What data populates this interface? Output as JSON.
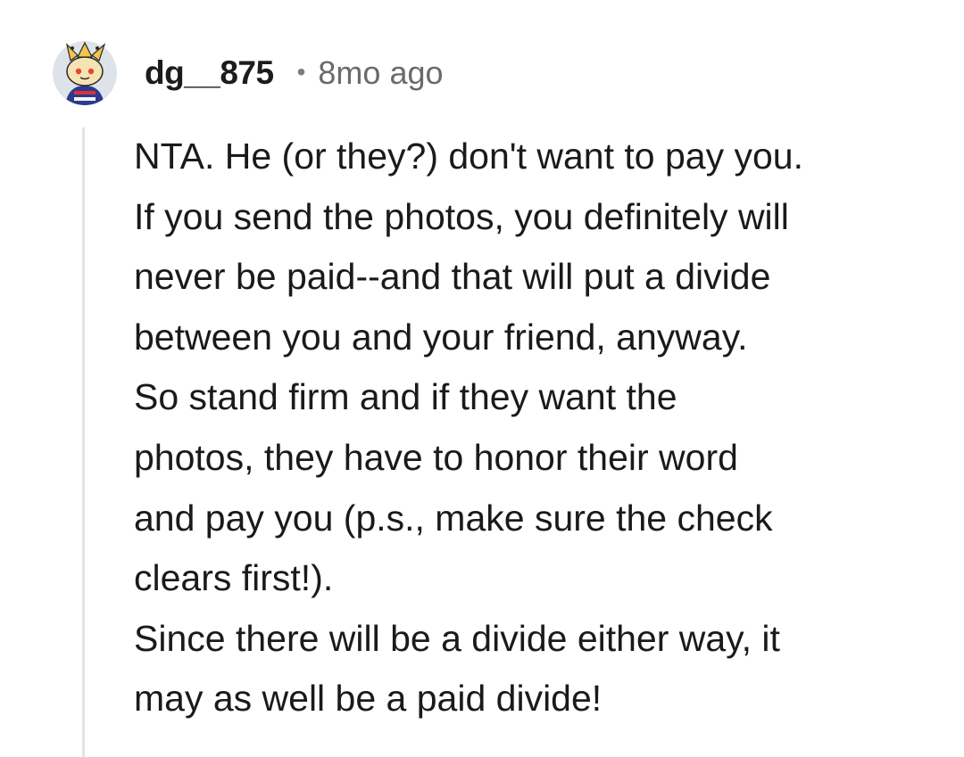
{
  "comment": {
    "author": "dg__875",
    "separator": "•",
    "age": "8mo ago",
    "avatar_icon": "snoo-avatar-icon",
    "body_lines": [
      "NTA. He (or they?) don't want to pay you.",
      "If you send the photos, you definitely will",
      "never be paid--and that will put a divide",
      "between you and your friend, anyway.",
      "So stand firm and if they want the",
      "photos, they have to honor their word",
      "and pay you (p.s., make sure the check",
      "clears first!).",
      "Since there will be a divide either way, it",
      "may as well be a paid divide!"
    ]
  },
  "colors": {
    "text": "#1a1a1b",
    "meta": "#6a6a6a",
    "thread_line": "#e3e3e3"
  }
}
